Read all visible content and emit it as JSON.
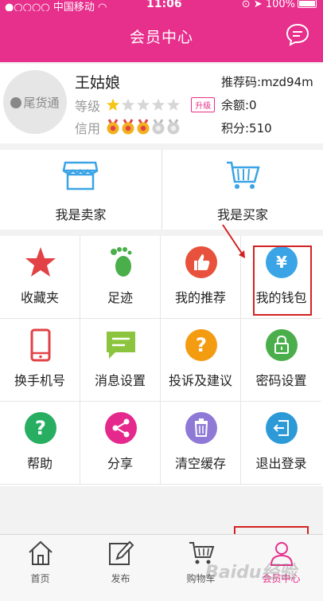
{
  "status_bar": {
    "carrier": "中国移动",
    "time": "11:06",
    "battery": "100%"
  },
  "header": {
    "title": "会员中心",
    "message_icon": "chat-bubble-icon"
  },
  "profile": {
    "avatar_text": "尾货通",
    "name": "王姑娘",
    "level_label": "等级",
    "level_stars": 1,
    "level_max": 5,
    "upgrade_label": "升级",
    "credit_label": "信用",
    "credit_medals": 3,
    "credit_max": 5,
    "referral_code": "推荐码:mzd94m",
    "balance": "余额:0",
    "points": "积分:510"
  },
  "roles": [
    {
      "label": "我是卖家",
      "icon": "shop-icon"
    },
    {
      "label": "我是买家",
      "icon": "cart-icon"
    }
  ],
  "menu": [
    {
      "label": "收藏夹",
      "icon": "star-icon",
      "color": "#e24245"
    },
    {
      "label": "足迹",
      "icon": "footprint-icon",
      "color": "#4aae4b"
    },
    {
      "label": "我的推荐",
      "icon": "thumbs-up-icon",
      "color": "#e8513b"
    },
    {
      "label": "我的钱包",
      "icon": "yuan-icon",
      "color": "#3aa4e6"
    },
    {
      "label": "换手机号",
      "icon": "phone-icon",
      "color": "#e24245"
    },
    {
      "label": "消息设置",
      "icon": "message-icon",
      "color": "#8cc43d"
    },
    {
      "label": "投诉及建议",
      "icon": "question-icon",
      "color": "#f39c12"
    },
    {
      "label": "密码设置",
      "icon": "lock-icon",
      "color": "#4aae4b"
    },
    {
      "label": "帮助",
      "icon": "help-icon",
      "color": "#27ae60"
    },
    {
      "label": "分享",
      "icon": "share-icon",
      "color": "#e5288c"
    },
    {
      "label": "清空缓存",
      "icon": "trash-icon",
      "color": "#8e7ad6"
    },
    {
      "label": "退出登录",
      "icon": "logout-icon",
      "color": "#2d9ad8"
    }
  ],
  "tabbar": [
    {
      "label": "首页",
      "icon": "home-icon",
      "active": false
    },
    {
      "label": "发布",
      "icon": "edit-icon",
      "active": false
    },
    {
      "label": "购物车",
      "icon": "cart-icon",
      "active": false
    },
    {
      "label": "会员中心",
      "icon": "user-icon",
      "active": true
    }
  ],
  "colors": {
    "brand": "#e72f8c",
    "annotation": "#d32222"
  },
  "watermark": "Baidu经验"
}
